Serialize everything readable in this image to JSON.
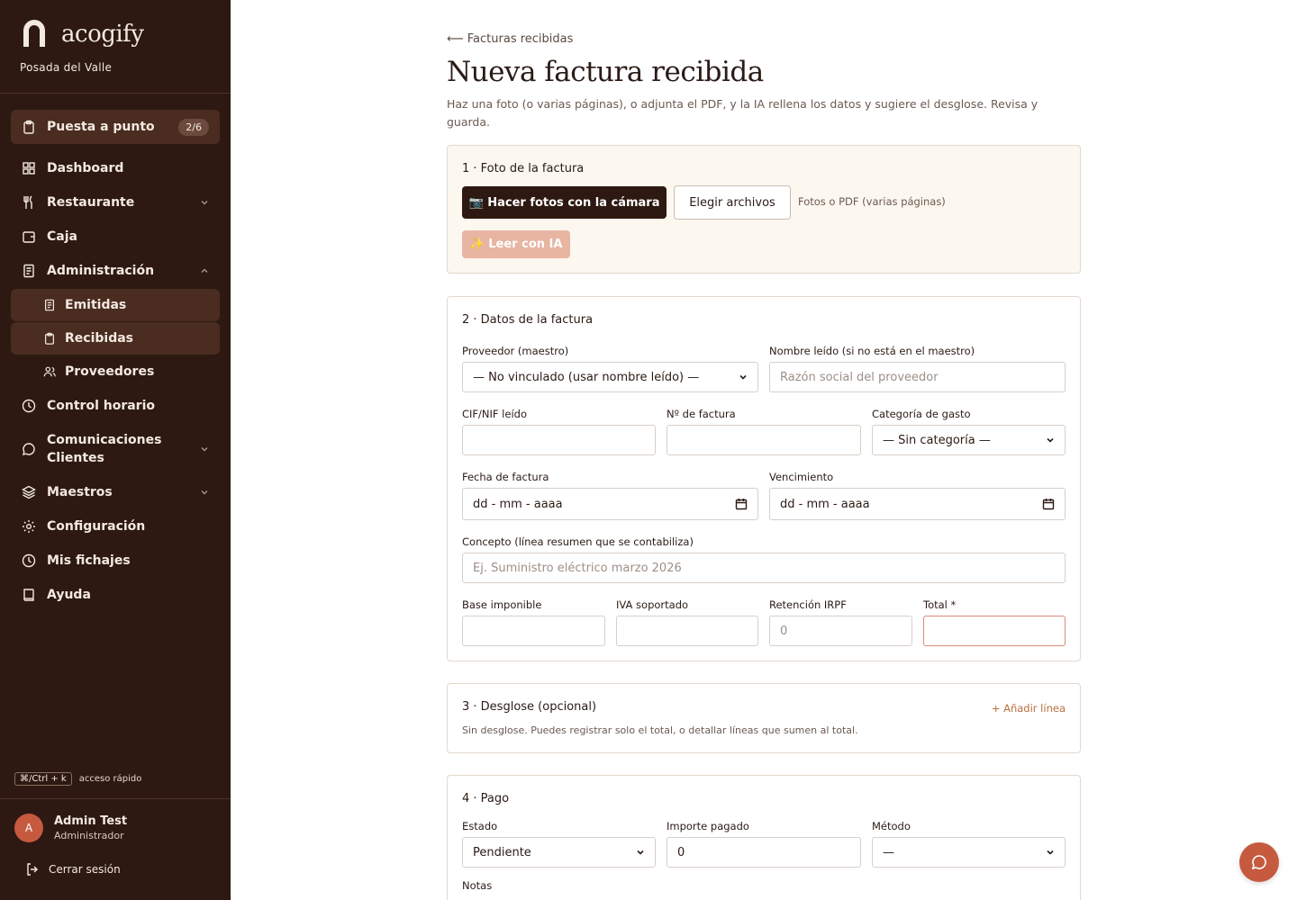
{
  "brand": {
    "name": "acogify",
    "property": "Posada del Valle"
  },
  "sidebar": {
    "setup": {
      "label": "Puesta a punto",
      "badge": "2/6"
    },
    "items": [
      {
        "label": "Dashboard"
      },
      {
        "label": "Restaurante"
      },
      {
        "label": "Caja"
      },
      {
        "label": "Administración"
      }
    ],
    "admin_sub": [
      {
        "label": "Emitidas"
      },
      {
        "label": "Recibidas"
      },
      {
        "label": "Proveedores"
      }
    ],
    "items2": [
      {
        "label": "Control horario"
      },
      {
        "label": "Comunicaciones Clientes"
      },
      {
        "label": "Maestros"
      },
      {
        "label": "Configuración"
      },
      {
        "label": "Mis fichajes"
      },
      {
        "label": "Ayuda"
      }
    ],
    "shortcut": {
      "key": "⌘/Ctrl + k",
      "label": "acceso rápido"
    },
    "user": {
      "initial": "A",
      "name": "Admin Test",
      "role": "Administrador"
    },
    "logout": "Cerrar sesión"
  },
  "header": {
    "back": "⟵ Facturas recibidas",
    "title": "Nueva factura recibida",
    "description": "Haz una foto (o varias páginas), o adjunta el PDF, y la IA rellena los datos y sugiere el desglose. Revisa y guarda."
  },
  "photo": {
    "title": "1 · Foto de la factura",
    "camera_button": "📷 Hacer fotos con la cámara",
    "files_button": "Elegir archivos",
    "hint": "Fotos o PDF (varias páginas)",
    "ai_button": "✨ Leer con IA"
  },
  "data": {
    "title": "2 · Datos de la factura",
    "supplier_label": "Proveedor (maestro)",
    "supplier_value": "— No vinculado (usar nombre leído) —",
    "name_label": "Nombre leído (si no está en el maestro)",
    "name_placeholder": "Razón social del proveedor",
    "cif_label": "CIF/NIF leído",
    "number_label": "Nº de factura",
    "category_label": "Categoría de gasto",
    "category_value": "— Sin categoría —",
    "date_label": "Fecha de factura",
    "date_placeholder": "dd - mm - aaaa",
    "due_label": "Vencimiento",
    "due_placeholder": "dd - mm - aaaa",
    "concept_label": "Concepto (línea resumen que se contabiliza)",
    "concept_placeholder": "Ej. Suministro eléctrico marzo 2026",
    "base_label": "Base imponible",
    "vat_label": "IVA soportado",
    "irpf_label": "Retención IRPF",
    "irpf_placeholder": "0",
    "total_label": "Total *"
  },
  "breakdown": {
    "title": "3 · Desglose (opcional)",
    "add_line": "+ Añadir línea",
    "note": "Sin desglose. Puedes registrar solo el total, o detallar líneas que sumen al total."
  },
  "payment": {
    "title": "4 · Pago",
    "status_label": "Estado",
    "status_value": "Pendiente",
    "paid_label": "Importe pagado",
    "paid_value": "0",
    "method_label": "Método",
    "method_value": "—",
    "notes_label": "Notas"
  },
  "colors": {
    "sidebar": "#2d1911",
    "accent": "#c65a3f",
    "active": "#4a2c20",
    "tint": "#fcf7ef"
  }
}
